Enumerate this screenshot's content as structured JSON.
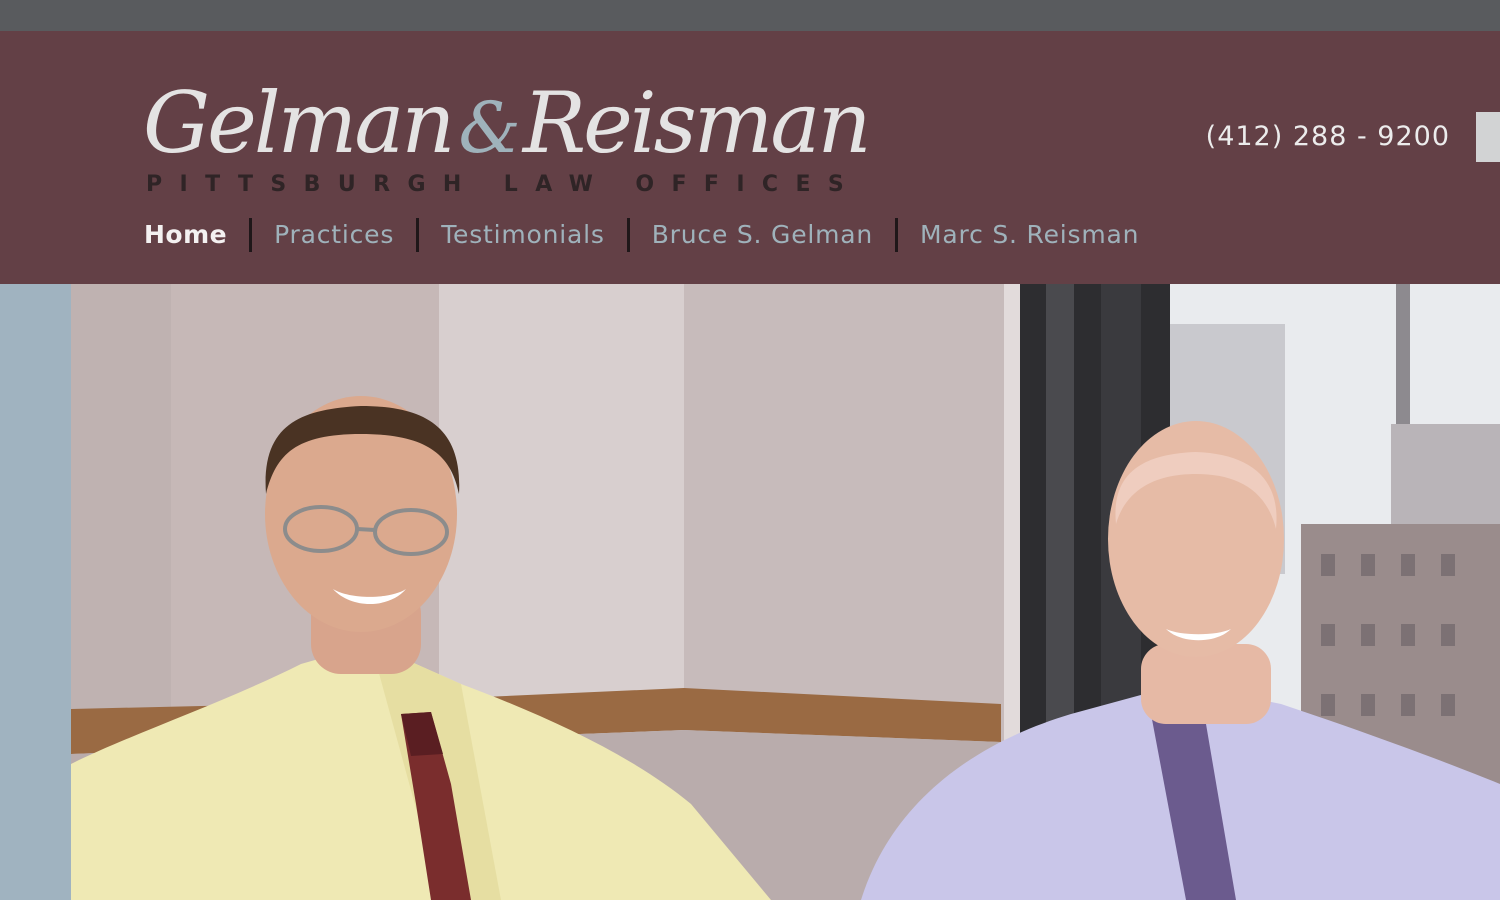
{
  "logo": {
    "first": "Gelman",
    "amp": "&",
    "second": "Reisman",
    "tagline": "PITTSBURGH LAW OFFICES"
  },
  "phone": "(412) 288 - 9200",
  "nav": {
    "items": [
      {
        "label": "Home",
        "active": true
      },
      {
        "label": "Practices"
      },
      {
        "label": "Testimonials"
      },
      {
        "label": "Bruce S. Gelman"
      },
      {
        "label": "Marc S. Reisman"
      }
    ]
  },
  "colors": {
    "top_bar": "#595b5e",
    "header": "#634046",
    "accent_blue": "#9fb2bb",
    "side_panel": "#a0b3c0"
  },
  "hero": {
    "image": "photo-two-men-office"
  }
}
